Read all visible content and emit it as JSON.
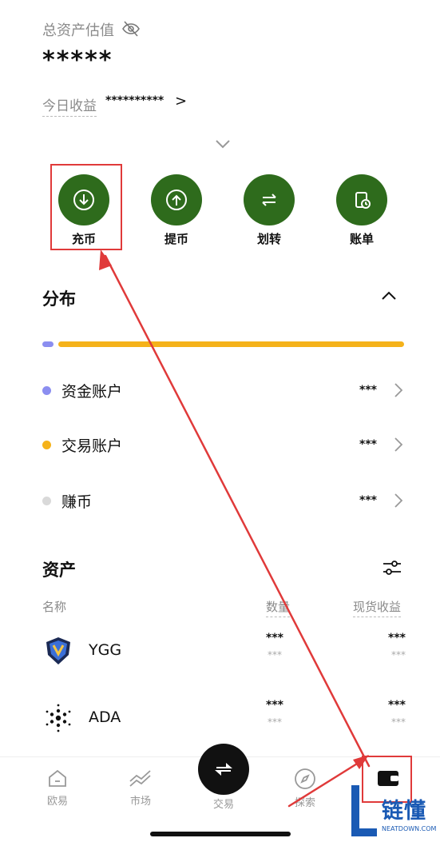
{
  "header": {
    "total_label": "总资产估值",
    "total_value": "*****",
    "today_label": "今日收益",
    "today_value": "**********",
    "today_chevron": ">"
  },
  "actions": [
    {
      "label": "充币",
      "icon": "deposit-icon"
    },
    {
      "label": "提币",
      "icon": "withdraw-icon"
    },
    {
      "label": "划转",
      "icon": "transfer-icon"
    },
    {
      "label": "账单",
      "icon": "bill-icon"
    }
  ],
  "distribution": {
    "title": "分布",
    "bar": {
      "funding_share": 0.03,
      "trading_share": 0.97
    },
    "accounts": [
      {
        "name": "资金账户",
        "value": "***",
        "color": "#8b8ef0"
      },
      {
        "name": "交易账户",
        "value": "***",
        "color": "#f5b21a"
      },
      {
        "name": "赚币",
        "value": "***",
        "color": "#d9d9d9"
      }
    ]
  },
  "assets": {
    "title": "资产",
    "col_name": "名称",
    "col_qty": "数量",
    "col_pnl": "现货收益",
    "rows": [
      {
        "name": "YGG",
        "qty": "***",
        "qty_sub": "***",
        "pnl": "***",
        "pnl_sub": "***"
      },
      {
        "name": "ADA",
        "qty": "***",
        "qty_sub": "***",
        "pnl": "***",
        "pnl_sub": "***"
      }
    ]
  },
  "tabbar": {
    "home": "欧易",
    "market": "市场",
    "trade": "交易",
    "explore": "探索"
  },
  "watermark": {
    "brand": "链懂",
    "site": "NEATDOWN.COM"
  },
  "colors": {
    "accent_green": "#2e6b1c",
    "annotation_red": "#e03a3a",
    "trading_bar": "#f5b21a",
    "funding_bar": "#8b8ef0"
  }
}
